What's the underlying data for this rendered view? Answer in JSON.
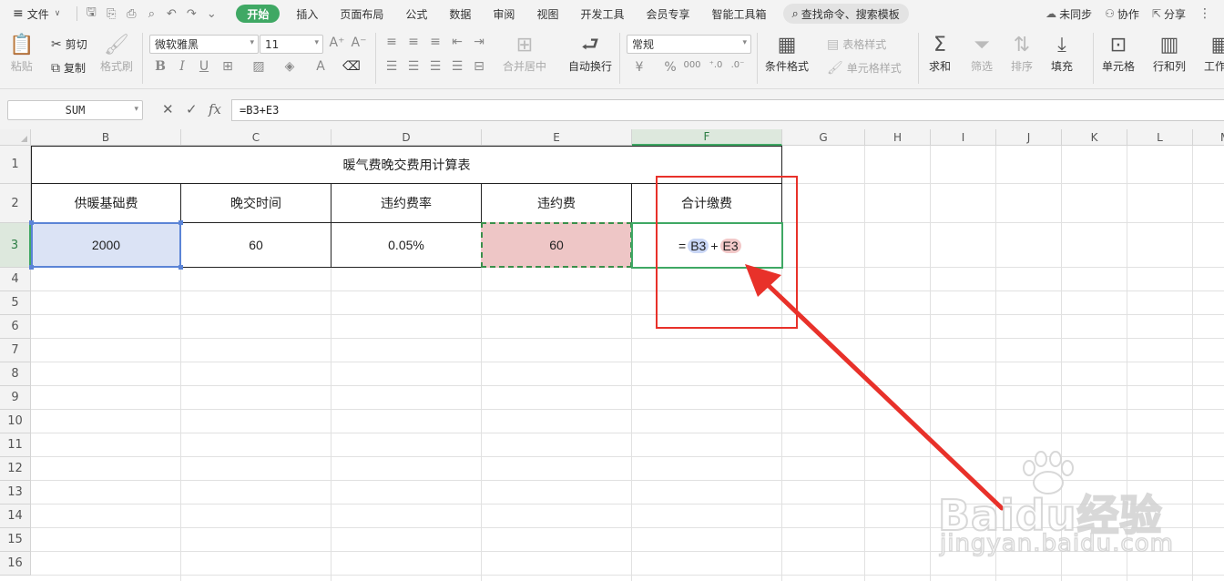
{
  "menubar": {
    "file_label": "文件",
    "tabs": [
      "开始",
      "插入",
      "页面布局",
      "公式",
      "数据",
      "审阅",
      "视图",
      "开发工具",
      "会员专享",
      "智能工具箱"
    ],
    "active_tab": "开始",
    "search_label": "查找命令、搜索模板",
    "sync_label": "未同步",
    "collab_label": "协作",
    "share_label": "分享"
  },
  "ribbon": {
    "paste": "粘贴",
    "cut": "剪切",
    "copy": "复制",
    "format_painter": "格式刷",
    "font_name": "微软雅黑",
    "font_size": "11",
    "merge_center": "合并居中",
    "wrap_text": "自动换行",
    "number_format": "常规",
    "conditional_format": "条件格式",
    "table_style": "表格样式",
    "cell_style": "单元格样式",
    "sum": "求和",
    "filter": "筛选",
    "sort": "排序",
    "fill": "填充",
    "cell": "单元格",
    "row_col": "行和列",
    "worksheet": "工作表",
    "currency_symbol": "¥",
    "percent_symbol": "%",
    "thousands_symbol": "000"
  },
  "formula_bar": {
    "name_box": "SUM",
    "fx_label": "fx",
    "formula": "=B3+E3"
  },
  "columns": [
    "B",
    "C",
    "D",
    "E",
    "F",
    "G",
    "H",
    "I",
    "J",
    "K",
    "L",
    "M"
  ],
  "rows": [
    "1",
    "2",
    "3",
    "4",
    "5",
    "6",
    "7",
    "8",
    "9",
    "10",
    "11",
    "12",
    "13",
    "14",
    "15",
    "16"
  ],
  "sheet": {
    "title": "暖气费晚交费用计算表",
    "headers": [
      "供暖基础费",
      "晚交时间",
      "违约费率",
      "违约费",
      "合计缴费"
    ],
    "values": [
      "2000",
      "60",
      "0.05%",
      "60"
    ],
    "formula_eq": "=",
    "formula_ref1": "B3",
    "formula_plus": "+",
    "formula_ref2": "E3"
  },
  "watermark": {
    "main": "Baidu经验",
    "sub": "jingyan.baidu.com"
  },
  "colors": {
    "accent_green": "#3fa864",
    "ref_blue": "#5b84d6",
    "ref_red_fill": "#eec6c6",
    "annotation_red": "#e8312a"
  }
}
